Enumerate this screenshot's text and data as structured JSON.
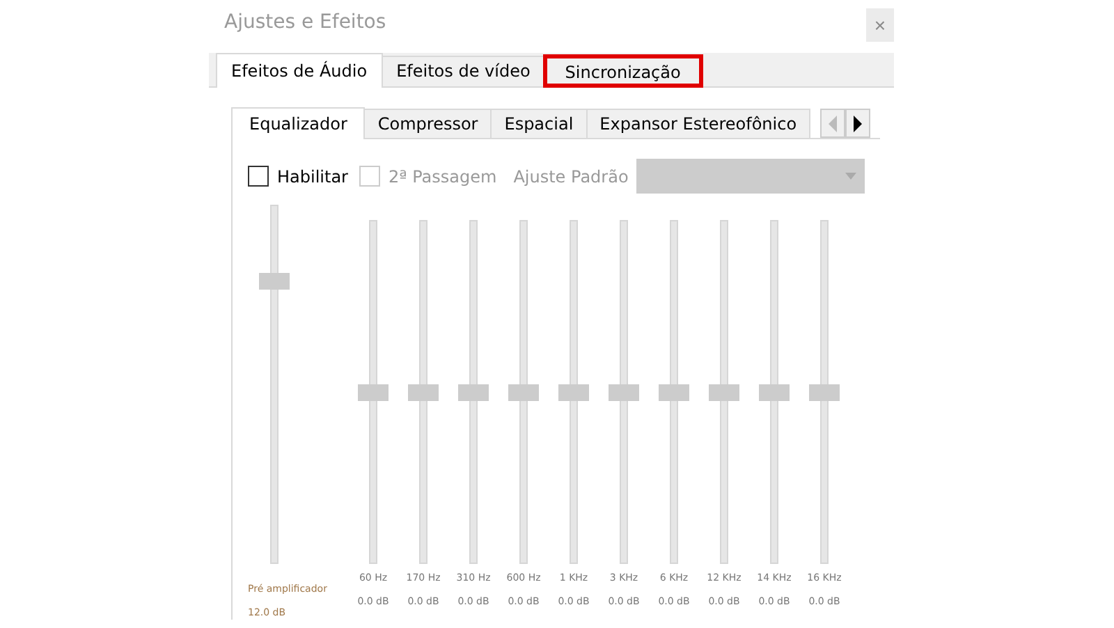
{
  "window": {
    "title": "Ajustes e Efeitos",
    "close": "×"
  },
  "tabs": [
    {
      "label": "Efeitos de Áudio",
      "selected": true,
      "highlighted": false
    },
    {
      "label": "Efeitos de vídeo",
      "selected": false,
      "highlighted": false
    },
    {
      "label": "Sincronização",
      "selected": false,
      "highlighted": true
    }
  ],
  "subtabs": [
    {
      "label": "Equalizador",
      "selected": true
    },
    {
      "label": "Compressor",
      "selected": false
    },
    {
      "label": "Espacial",
      "selected": false
    },
    {
      "label": "Expansor Estereofônico",
      "selected": false
    }
  ],
  "subtab_scroll": {
    "left_disabled": true,
    "right_disabled": false
  },
  "options": [
    {
      "kind": "checkbox",
      "label": "Habilitar",
      "checked": false,
      "disabled": false
    },
    {
      "kind": "checkbox",
      "label": "2ª Passagem",
      "checked": false,
      "disabled": true
    },
    {
      "kind": "dropdown",
      "label": "Ajuste Padrão",
      "disabled": true
    }
  ],
  "preamp": {
    "label": "Pré amplificador",
    "reading": "12.0 dB",
    "level": 0.8
  },
  "bands": [
    {
      "label": "60 Hz",
      "reading": "0.0 dB",
      "level": 0.5
    },
    {
      "label": "170 Hz",
      "reading": "0.0 dB",
      "level": 0.5
    },
    {
      "label": "310 Hz",
      "reading": "0.0 dB",
      "level": 0.5
    },
    {
      "label": "600 Hz",
      "reading": "0.0 dB",
      "level": 0.5
    },
    {
      "label": "1 KHz",
      "reading": "0.0 dB",
      "level": 0.5
    },
    {
      "label": "3 KHz",
      "reading": "0.0 dB",
      "level": 0.5
    },
    {
      "label": "6 KHz",
      "reading": "0.0 dB",
      "level": 0.5
    },
    {
      "label": "12 KHz",
      "reading": "0.0 dB",
      "level": 0.5
    },
    {
      "label": "14 KHz",
      "reading": "0.0 dB",
      "level": 0.5
    },
    {
      "label": "16 KHz",
      "reading": "0.0 dB",
      "level": 0.5
    }
  ]
}
